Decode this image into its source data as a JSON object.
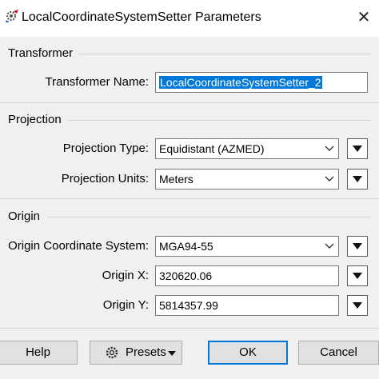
{
  "window": {
    "title": "LocalCoordinateSystemSetter Parameters",
    "close_glyph": "✕"
  },
  "transformer": {
    "group_label": "Transformer",
    "name_label": "Transformer Name:",
    "name_value": "LocalCoordinateSystemSetter_2"
  },
  "projection": {
    "group_label": "Projection",
    "type_label": "Projection Type:",
    "type_value": "Equidistant (AZMED)",
    "units_label": "Projection Units:",
    "units_value": "Meters"
  },
  "origin": {
    "group_label": "Origin",
    "cs_label": "Origin Coordinate System:",
    "cs_value": "MGA94-55",
    "x_label": "Origin X:",
    "x_value": "320620.06",
    "y_label": "Origin Y:",
    "y_value": "5814357.99"
  },
  "buttons": {
    "help": "Help",
    "presets": "Presets",
    "ok": "OK",
    "cancel": "Cancel"
  },
  "icons": {
    "app": "transformer-gear-icon",
    "close": "close-icon",
    "combo": "chevron-down-icon",
    "menu": "triangle-down-icon",
    "presets": "gear-icon"
  },
  "colors": {
    "selection": "#0078d7",
    "default_button_border": "#0078d7"
  }
}
